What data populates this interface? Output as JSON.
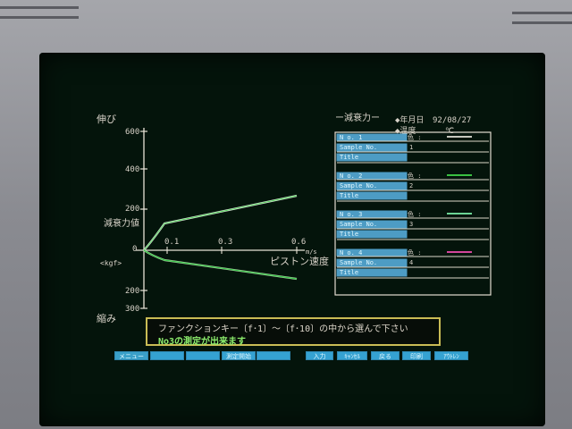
{
  "chart": {
    "y_labels": {
      "top": "600",
      "mid1": "400",
      "mid2": "200",
      "zero": "0",
      "neg1": "200",
      "neg2": "300"
    },
    "x_labels": [
      "0.1",
      "0.3",
      "0.6"
    ],
    "y_title_top": "伸び",
    "y_title_bottom": "縮み",
    "y_axis_label": "減衰力値",
    "y_unit": "<kgf>",
    "x_axis_label": "ピストン速度",
    "x_unit": "m/s"
  },
  "panel": {
    "heading": "ー減衰力ー",
    "date_label": "◆年月日",
    "date_value": "92/08/27",
    "temp_label": "◆温度",
    "temp_value": "℃",
    "rows": [
      {
        "no": "N o. 1",
        "sample_label": "Sample No.",
        "sample_value": "1",
        "title_label": "Title",
        "color_label": "色 :",
        "color": "#e4e2d8"
      },
      {
        "no": "N o. 2",
        "sample_label": "Sample No.",
        "sample_value": "2",
        "title_label": "Title",
        "color_label": "色 :",
        "color": "#42d84a"
      },
      {
        "no": "N o. 3",
        "sample_label": "Sample No.",
        "sample_value": "3",
        "title_label": "Title",
        "color_label": "色 :",
        "color": "#7af0a8"
      },
      {
        "no": "N o. 4",
        "sample_label": "Sample No.",
        "sample_value": "4",
        "title_label": "Title",
        "color_label": "色 :",
        "color": "#f14db1"
      }
    ]
  },
  "message": {
    "line1": "ファンクションキー〔f･1〕～〔f･10〕の中から選んで下さい",
    "line2": "No3の測定が出来ます"
  },
  "fkeys": {
    "left": [
      "メニュー",
      "",
      "",
      "測定開始",
      ""
    ],
    "right": [
      "入力",
      "ｷｬﾝｾﾙ",
      "戻る",
      "印刷",
      "ｱｳﾄﾚﾝ"
    ]
  },
  "colors": {
    "bezel": "#8f8f94",
    "screen": "#04140b",
    "axis": "#e8e3d7",
    "curve1": "#e4e2d8",
    "curve2": "#38c844"
  }
}
